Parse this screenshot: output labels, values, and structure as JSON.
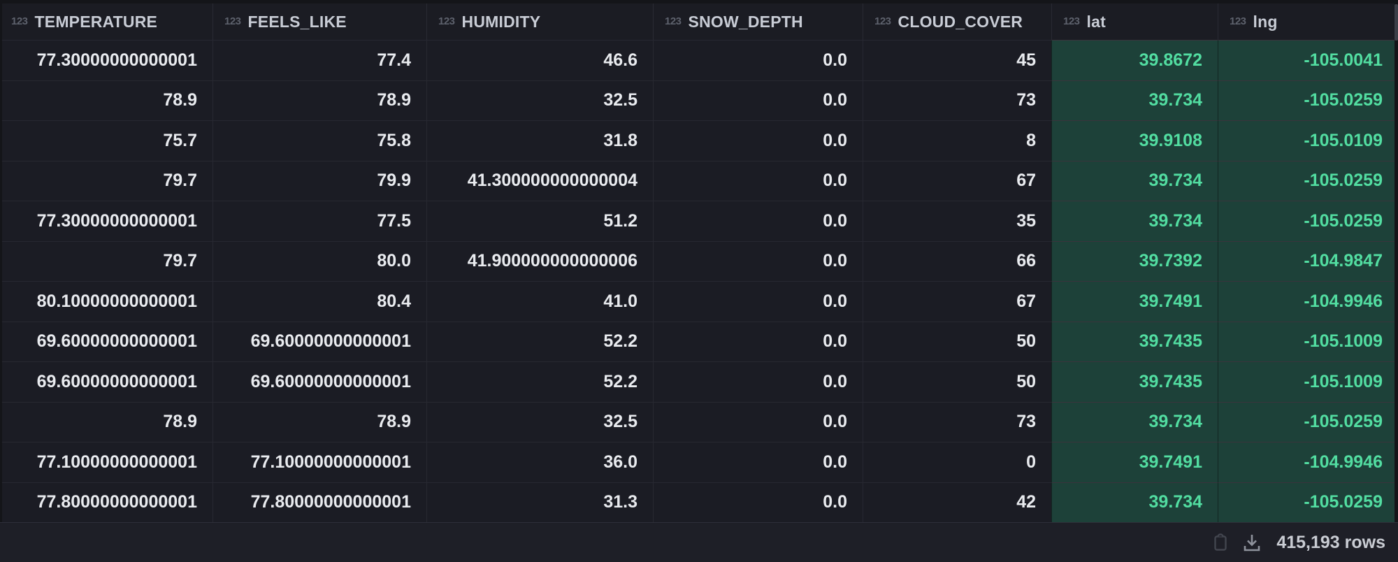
{
  "colors": {
    "page_bg": "#141519",
    "cell_bg": "#1b1c24",
    "header_bg": "#1b1c23",
    "highlight_bg": "#1d4139",
    "highlight_text": "#52dda1",
    "header_text": "#c8ccd5",
    "cell_text": "#e9ebef"
  },
  "table": {
    "columns": [
      {
        "name": "TEMPERATURE",
        "type_icon": "123",
        "highlight": false
      },
      {
        "name": "FEELS_LIKE",
        "type_icon": "123",
        "highlight": false
      },
      {
        "name": "HUMIDITY",
        "type_icon": "123",
        "highlight": false
      },
      {
        "name": "SNOW_DEPTH",
        "type_icon": "123",
        "highlight": false
      },
      {
        "name": "CLOUD_COVER",
        "type_icon": "123",
        "highlight": false
      },
      {
        "name": "lat",
        "type_icon": "123",
        "highlight": true
      },
      {
        "name": "lng",
        "type_icon": "123",
        "highlight": true
      }
    ],
    "rows": [
      [
        "77.30000000000001",
        "77.4",
        "46.6",
        "0.0",
        "45",
        "39.8672",
        "-105.0041"
      ],
      [
        "78.9",
        "78.9",
        "32.5",
        "0.0",
        "73",
        "39.734",
        "-105.0259"
      ],
      [
        "75.7",
        "75.8",
        "31.8",
        "0.0",
        "8",
        "39.9108",
        "-105.0109"
      ],
      [
        "79.7",
        "79.9",
        "41.300000000000004",
        "0.0",
        "67",
        "39.734",
        "-105.0259"
      ],
      [
        "77.30000000000001",
        "77.5",
        "51.2",
        "0.0",
        "35",
        "39.734",
        "-105.0259"
      ],
      [
        "79.7",
        "80.0",
        "41.900000000000006",
        "0.0",
        "66",
        "39.7392",
        "-104.9847"
      ],
      [
        "80.10000000000001",
        "80.4",
        "41.0",
        "0.0",
        "67",
        "39.7491",
        "-104.9946"
      ],
      [
        "69.60000000000001",
        "69.60000000000001",
        "52.2",
        "0.0",
        "50",
        "39.7435",
        "-105.1009"
      ],
      [
        "69.60000000000001",
        "69.60000000000001",
        "52.2",
        "0.0",
        "50",
        "39.7435",
        "-105.1009"
      ],
      [
        "78.9",
        "78.9",
        "32.5",
        "0.0",
        "73",
        "39.734",
        "-105.0259"
      ],
      [
        "77.10000000000001",
        "77.10000000000001",
        "36.0",
        "0.0",
        "0",
        "39.7491",
        "-104.9946"
      ],
      [
        "77.80000000000001",
        "77.80000000000001",
        "31.3",
        "0.0",
        "42",
        "39.734",
        "-105.0259"
      ]
    ]
  },
  "footer": {
    "row_count": "415,193 rows",
    "icons": [
      "copy-to-clipboard-icon",
      "download-icon"
    ]
  }
}
